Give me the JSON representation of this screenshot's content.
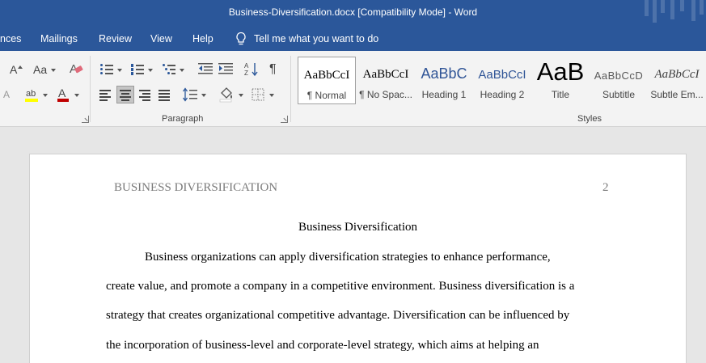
{
  "window": {
    "title": "Business-Diversification.docx [Compatibility Mode]  -  Word"
  },
  "tabs": [
    {
      "label": "nces"
    },
    {
      "label": "Mailings"
    },
    {
      "label": "Review"
    },
    {
      "label": "View"
    },
    {
      "label": "Help"
    }
  ],
  "tell_me": {
    "placeholder": "Tell me what you want to do"
  },
  "font_group": {
    "grow_label": "A",
    "case_label": "Aa",
    "clear_label": "A",
    "font_color": "#c00000",
    "highlight_color": "#ffff00"
  },
  "paragraph_group": {
    "label": "Paragraph",
    "pilcrow": "¶"
  },
  "styles_group": {
    "label": "Styles",
    "items": [
      {
        "preview": "AaBbCcI",
        "name": "¶ Normal"
      },
      {
        "preview": "AaBbCcI",
        "name": "¶ No Spac..."
      },
      {
        "preview": "AaBbC",
        "name": "Heading 1"
      },
      {
        "preview": "AaBbCcI",
        "name": "Heading 2"
      },
      {
        "preview": "AaB",
        "name": "Title"
      },
      {
        "preview": "AaBbCcD",
        "name": "Subtitle"
      },
      {
        "preview": "AaBbCcI",
        "name": "Subtle Em..."
      }
    ]
  },
  "document": {
    "running_head": "BUSINESS DIVERSIFICATION",
    "page_number": "2",
    "heading": "Business Diversification",
    "lines": [
      "Business organizations can apply diversification strategies to enhance performance,",
      "create value, and promote a company in a competitive environment. Business diversification is a",
      "strategy that creates organizational competitive advantage. Diversification can be influenced by",
      "the incorporation of business-level and corporate-level strategy, which aims at helping an"
    ]
  },
  "colors": {
    "brand": "#2b579a",
    "ribbon_bg": "#f3f3f3",
    "canvas_bg": "#e6e6e6"
  }
}
